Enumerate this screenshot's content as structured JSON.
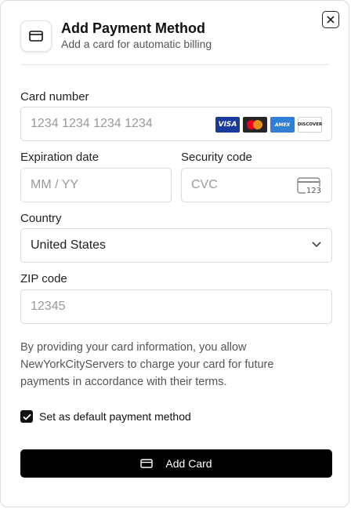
{
  "header": {
    "title": "Add Payment Method",
    "subtitle": "Add a card for automatic billing",
    "icon": "credit-card-icon",
    "close_icon": "close-icon"
  },
  "card_number": {
    "label": "Card number",
    "placeholder": "1234 1234 1234 1234",
    "brands": [
      {
        "name": "visa",
        "text": "VISA"
      },
      {
        "name": "mastercard",
        "text": ""
      },
      {
        "name": "amex",
        "text": "AMEX"
      },
      {
        "name": "discover",
        "text": "DISCOVER"
      }
    ]
  },
  "expiration": {
    "label": "Expiration date",
    "placeholder": "MM / YY"
  },
  "security": {
    "label": "Security code",
    "placeholder": "CVC",
    "icon_text": "123"
  },
  "country": {
    "label": "Country",
    "selected": "United States"
  },
  "zip": {
    "label": "ZIP code",
    "placeholder": "12345"
  },
  "notice": "By providing your card information, you allow NewYorkCityServers to charge your card for future payments in accordance with their terms.",
  "default_checkbox": {
    "label": "Set as default payment method",
    "checked": true
  },
  "submit": {
    "label": "Add Card",
    "icon": "credit-card-icon"
  },
  "colors": {
    "button_bg": "#000000",
    "border": "#dadada",
    "visa": "#1a3a9b",
    "amex": "#2f7fd6",
    "mc_red": "#eb001b",
    "mc_orange": "#f79e1b"
  }
}
